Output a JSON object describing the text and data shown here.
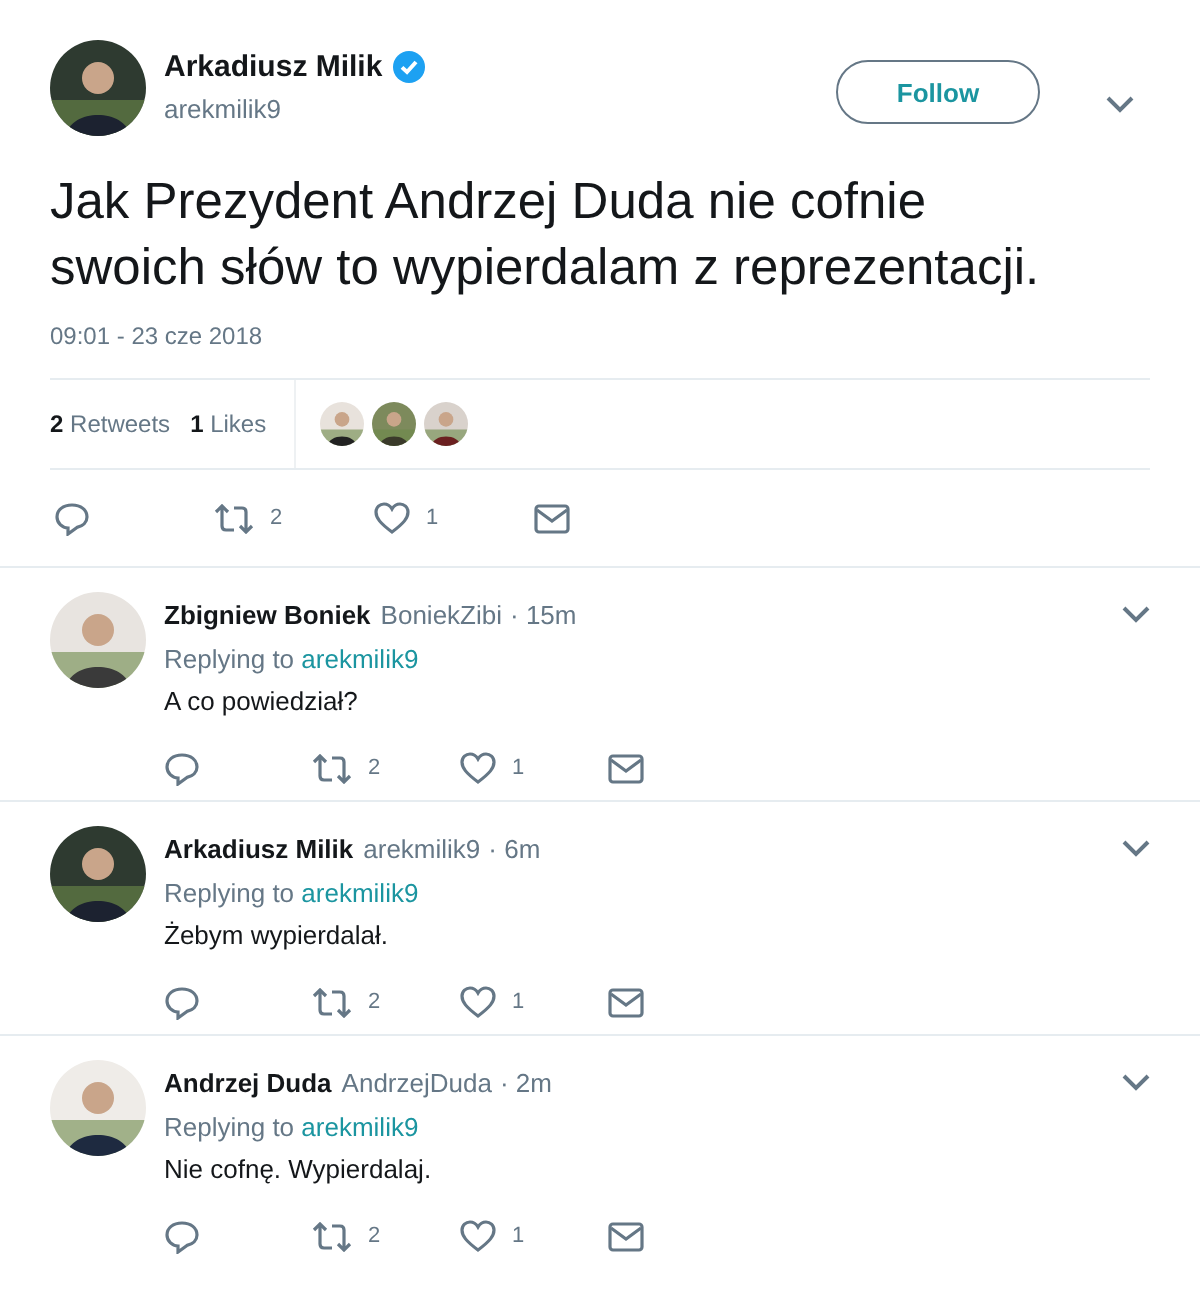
{
  "tweet": {
    "author": {
      "name": "Arkadiusz Milik",
      "handle": "arekmilik9",
      "verified": true
    },
    "follow_button": "Follow",
    "text": "Jak Prezydent Andrzej Duda nie cofnie swoich słów to wypierdalam z reprezentacji.",
    "timestamp": "09:01 - 23 cze 2018",
    "stats": [
      {
        "count": "2",
        "label": "Retweets"
      },
      {
        "count": "1",
        "label": "Likes"
      }
    ],
    "actions": [
      {
        "kind": "reply"
      },
      {
        "kind": "retweet",
        "count": "2"
      },
      {
        "kind": "like",
        "count": "1"
      },
      {
        "kind": "message"
      }
    ]
  },
  "replies": [
    {
      "name": "Zbigniew Boniek",
      "handle": "BoniekZibi",
      "time": "· 15m",
      "replying_label": "Replying to",
      "replying_to": "arekmilik9",
      "text": "A co powiedział?",
      "actions": [
        {
          "kind": "reply"
        },
        {
          "kind": "retweet",
          "count": "2"
        },
        {
          "kind": "like",
          "count": "1"
        },
        {
          "kind": "message"
        }
      ]
    },
    {
      "name": "Arkadiusz Milik",
      "handle": "arekmilik9",
      "time": "· 6m",
      "replying_label": "Replying to",
      "replying_to": "arekmilik9",
      "text": "Żebym wypierdalał.",
      "actions": [
        {
          "kind": "reply"
        },
        {
          "kind": "retweet",
          "count": "2"
        },
        {
          "kind": "like",
          "count": "1"
        },
        {
          "kind": "message"
        }
      ]
    },
    {
      "name": "Andrzej Duda",
      "handle": "AndrzejDuda",
      "time": "· 2m",
      "replying_label": "Replying to",
      "replying_to": "arekmilik9",
      "text": "Nie cofnę. Wypierdalaj.",
      "actions": [
        {
          "kind": "reply"
        },
        {
          "kind": "retweet",
          "count": "2"
        },
        {
          "kind": "like",
          "count": "1"
        },
        {
          "kind": "message"
        }
      ]
    }
  ]
}
